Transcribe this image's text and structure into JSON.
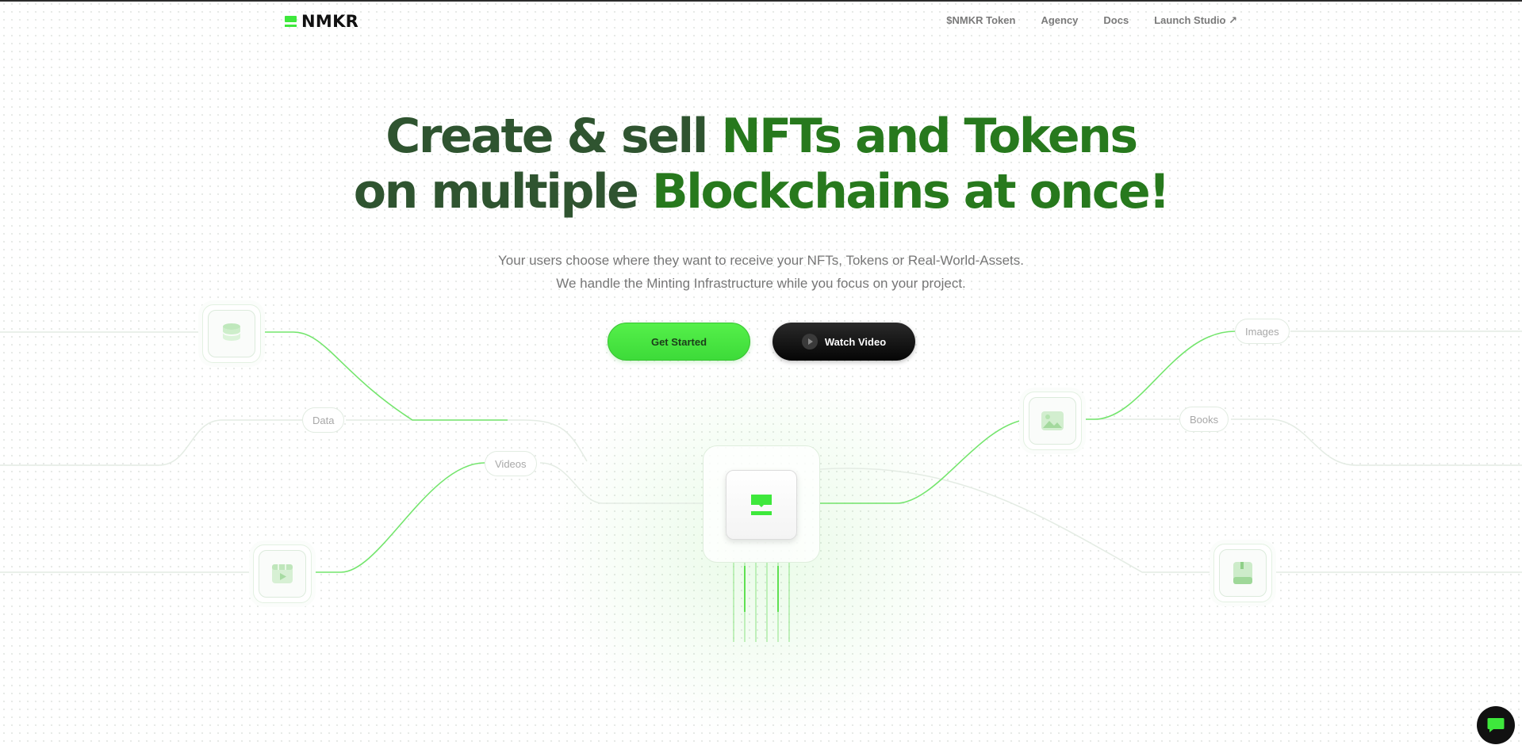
{
  "brand": {
    "name": "NMKR",
    "accent": "#3ee83c",
    "title_dark": "#2f5430",
    "title_green": "#27791d"
  },
  "nav": {
    "items": [
      {
        "label": "$NMKR Token"
      },
      {
        "label": "Agency"
      },
      {
        "label": "Docs"
      },
      {
        "label": "Launch Studio ↗"
      }
    ]
  },
  "hero": {
    "title_line1_a": "Create & sell ",
    "title_line1_b": "NFTs and Tokens",
    "title_line2_a": "on multiple ",
    "title_line2_b": "Blockchains at once!",
    "subtitle_line1": "Your users choose where they want to receive your NFTs, Tokens or Real-World-Assets.",
    "subtitle_line2": "We handle the Minting Infrastructure while you focus on your project.",
    "primary_button": "Get Started",
    "secondary_button": "Watch Video"
  },
  "diagram": {
    "labels": {
      "data": "Data",
      "videos": "Videos",
      "images": "Images",
      "books": "Books"
    },
    "icons": [
      "database-icon",
      "video-icon",
      "image-icon",
      "book-icon",
      "nmkr-hub-icon"
    ]
  },
  "chat": {
    "icon": "chat-icon"
  }
}
